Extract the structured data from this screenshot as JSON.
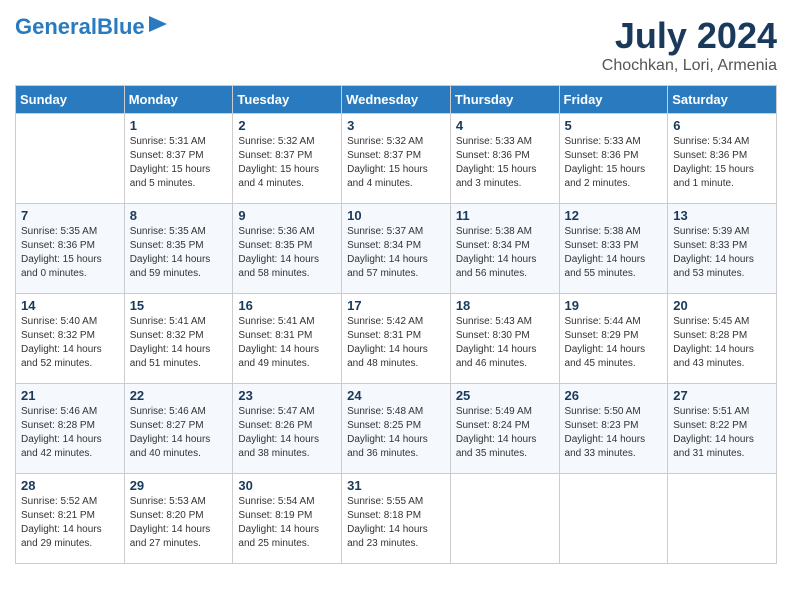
{
  "header": {
    "logo_line1": "General",
    "logo_line2": "Blue",
    "month_title": "July 2024",
    "location": "Chochkan, Lori, Armenia"
  },
  "days_of_week": [
    "Sunday",
    "Monday",
    "Tuesday",
    "Wednesday",
    "Thursday",
    "Friday",
    "Saturday"
  ],
  "weeks": [
    [
      {
        "day": "",
        "content": ""
      },
      {
        "day": "1",
        "content": "Sunrise: 5:31 AM\nSunset: 8:37 PM\nDaylight: 15 hours\nand 5 minutes."
      },
      {
        "day": "2",
        "content": "Sunrise: 5:32 AM\nSunset: 8:37 PM\nDaylight: 15 hours\nand 4 minutes."
      },
      {
        "day": "3",
        "content": "Sunrise: 5:32 AM\nSunset: 8:37 PM\nDaylight: 15 hours\nand 4 minutes."
      },
      {
        "day": "4",
        "content": "Sunrise: 5:33 AM\nSunset: 8:36 PM\nDaylight: 15 hours\nand 3 minutes."
      },
      {
        "day": "5",
        "content": "Sunrise: 5:33 AM\nSunset: 8:36 PM\nDaylight: 15 hours\nand 2 minutes."
      },
      {
        "day": "6",
        "content": "Sunrise: 5:34 AM\nSunset: 8:36 PM\nDaylight: 15 hours\nand 1 minute."
      }
    ],
    [
      {
        "day": "7",
        "content": "Sunrise: 5:35 AM\nSunset: 8:36 PM\nDaylight: 15 hours\nand 0 minutes."
      },
      {
        "day": "8",
        "content": "Sunrise: 5:35 AM\nSunset: 8:35 PM\nDaylight: 14 hours\nand 59 minutes."
      },
      {
        "day": "9",
        "content": "Sunrise: 5:36 AM\nSunset: 8:35 PM\nDaylight: 14 hours\nand 58 minutes."
      },
      {
        "day": "10",
        "content": "Sunrise: 5:37 AM\nSunset: 8:34 PM\nDaylight: 14 hours\nand 57 minutes."
      },
      {
        "day": "11",
        "content": "Sunrise: 5:38 AM\nSunset: 8:34 PM\nDaylight: 14 hours\nand 56 minutes."
      },
      {
        "day": "12",
        "content": "Sunrise: 5:38 AM\nSunset: 8:33 PM\nDaylight: 14 hours\nand 55 minutes."
      },
      {
        "day": "13",
        "content": "Sunrise: 5:39 AM\nSunset: 8:33 PM\nDaylight: 14 hours\nand 53 minutes."
      }
    ],
    [
      {
        "day": "14",
        "content": "Sunrise: 5:40 AM\nSunset: 8:32 PM\nDaylight: 14 hours\nand 52 minutes."
      },
      {
        "day": "15",
        "content": "Sunrise: 5:41 AM\nSunset: 8:32 PM\nDaylight: 14 hours\nand 51 minutes."
      },
      {
        "day": "16",
        "content": "Sunrise: 5:41 AM\nSunset: 8:31 PM\nDaylight: 14 hours\nand 49 minutes."
      },
      {
        "day": "17",
        "content": "Sunrise: 5:42 AM\nSunset: 8:31 PM\nDaylight: 14 hours\nand 48 minutes."
      },
      {
        "day": "18",
        "content": "Sunrise: 5:43 AM\nSunset: 8:30 PM\nDaylight: 14 hours\nand 46 minutes."
      },
      {
        "day": "19",
        "content": "Sunrise: 5:44 AM\nSunset: 8:29 PM\nDaylight: 14 hours\nand 45 minutes."
      },
      {
        "day": "20",
        "content": "Sunrise: 5:45 AM\nSunset: 8:28 PM\nDaylight: 14 hours\nand 43 minutes."
      }
    ],
    [
      {
        "day": "21",
        "content": "Sunrise: 5:46 AM\nSunset: 8:28 PM\nDaylight: 14 hours\nand 42 minutes."
      },
      {
        "day": "22",
        "content": "Sunrise: 5:46 AM\nSunset: 8:27 PM\nDaylight: 14 hours\nand 40 minutes."
      },
      {
        "day": "23",
        "content": "Sunrise: 5:47 AM\nSunset: 8:26 PM\nDaylight: 14 hours\nand 38 minutes."
      },
      {
        "day": "24",
        "content": "Sunrise: 5:48 AM\nSunset: 8:25 PM\nDaylight: 14 hours\nand 36 minutes."
      },
      {
        "day": "25",
        "content": "Sunrise: 5:49 AM\nSunset: 8:24 PM\nDaylight: 14 hours\nand 35 minutes."
      },
      {
        "day": "26",
        "content": "Sunrise: 5:50 AM\nSunset: 8:23 PM\nDaylight: 14 hours\nand 33 minutes."
      },
      {
        "day": "27",
        "content": "Sunrise: 5:51 AM\nSunset: 8:22 PM\nDaylight: 14 hours\nand 31 minutes."
      }
    ],
    [
      {
        "day": "28",
        "content": "Sunrise: 5:52 AM\nSunset: 8:21 PM\nDaylight: 14 hours\nand 29 minutes."
      },
      {
        "day": "29",
        "content": "Sunrise: 5:53 AM\nSunset: 8:20 PM\nDaylight: 14 hours\nand 27 minutes."
      },
      {
        "day": "30",
        "content": "Sunrise: 5:54 AM\nSunset: 8:19 PM\nDaylight: 14 hours\nand 25 minutes."
      },
      {
        "day": "31",
        "content": "Sunrise: 5:55 AM\nSunset: 8:18 PM\nDaylight: 14 hours\nand 23 minutes."
      },
      {
        "day": "",
        "content": ""
      },
      {
        "day": "",
        "content": ""
      },
      {
        "day": "",
        "content": ""
      }
    ]
  ]
}
